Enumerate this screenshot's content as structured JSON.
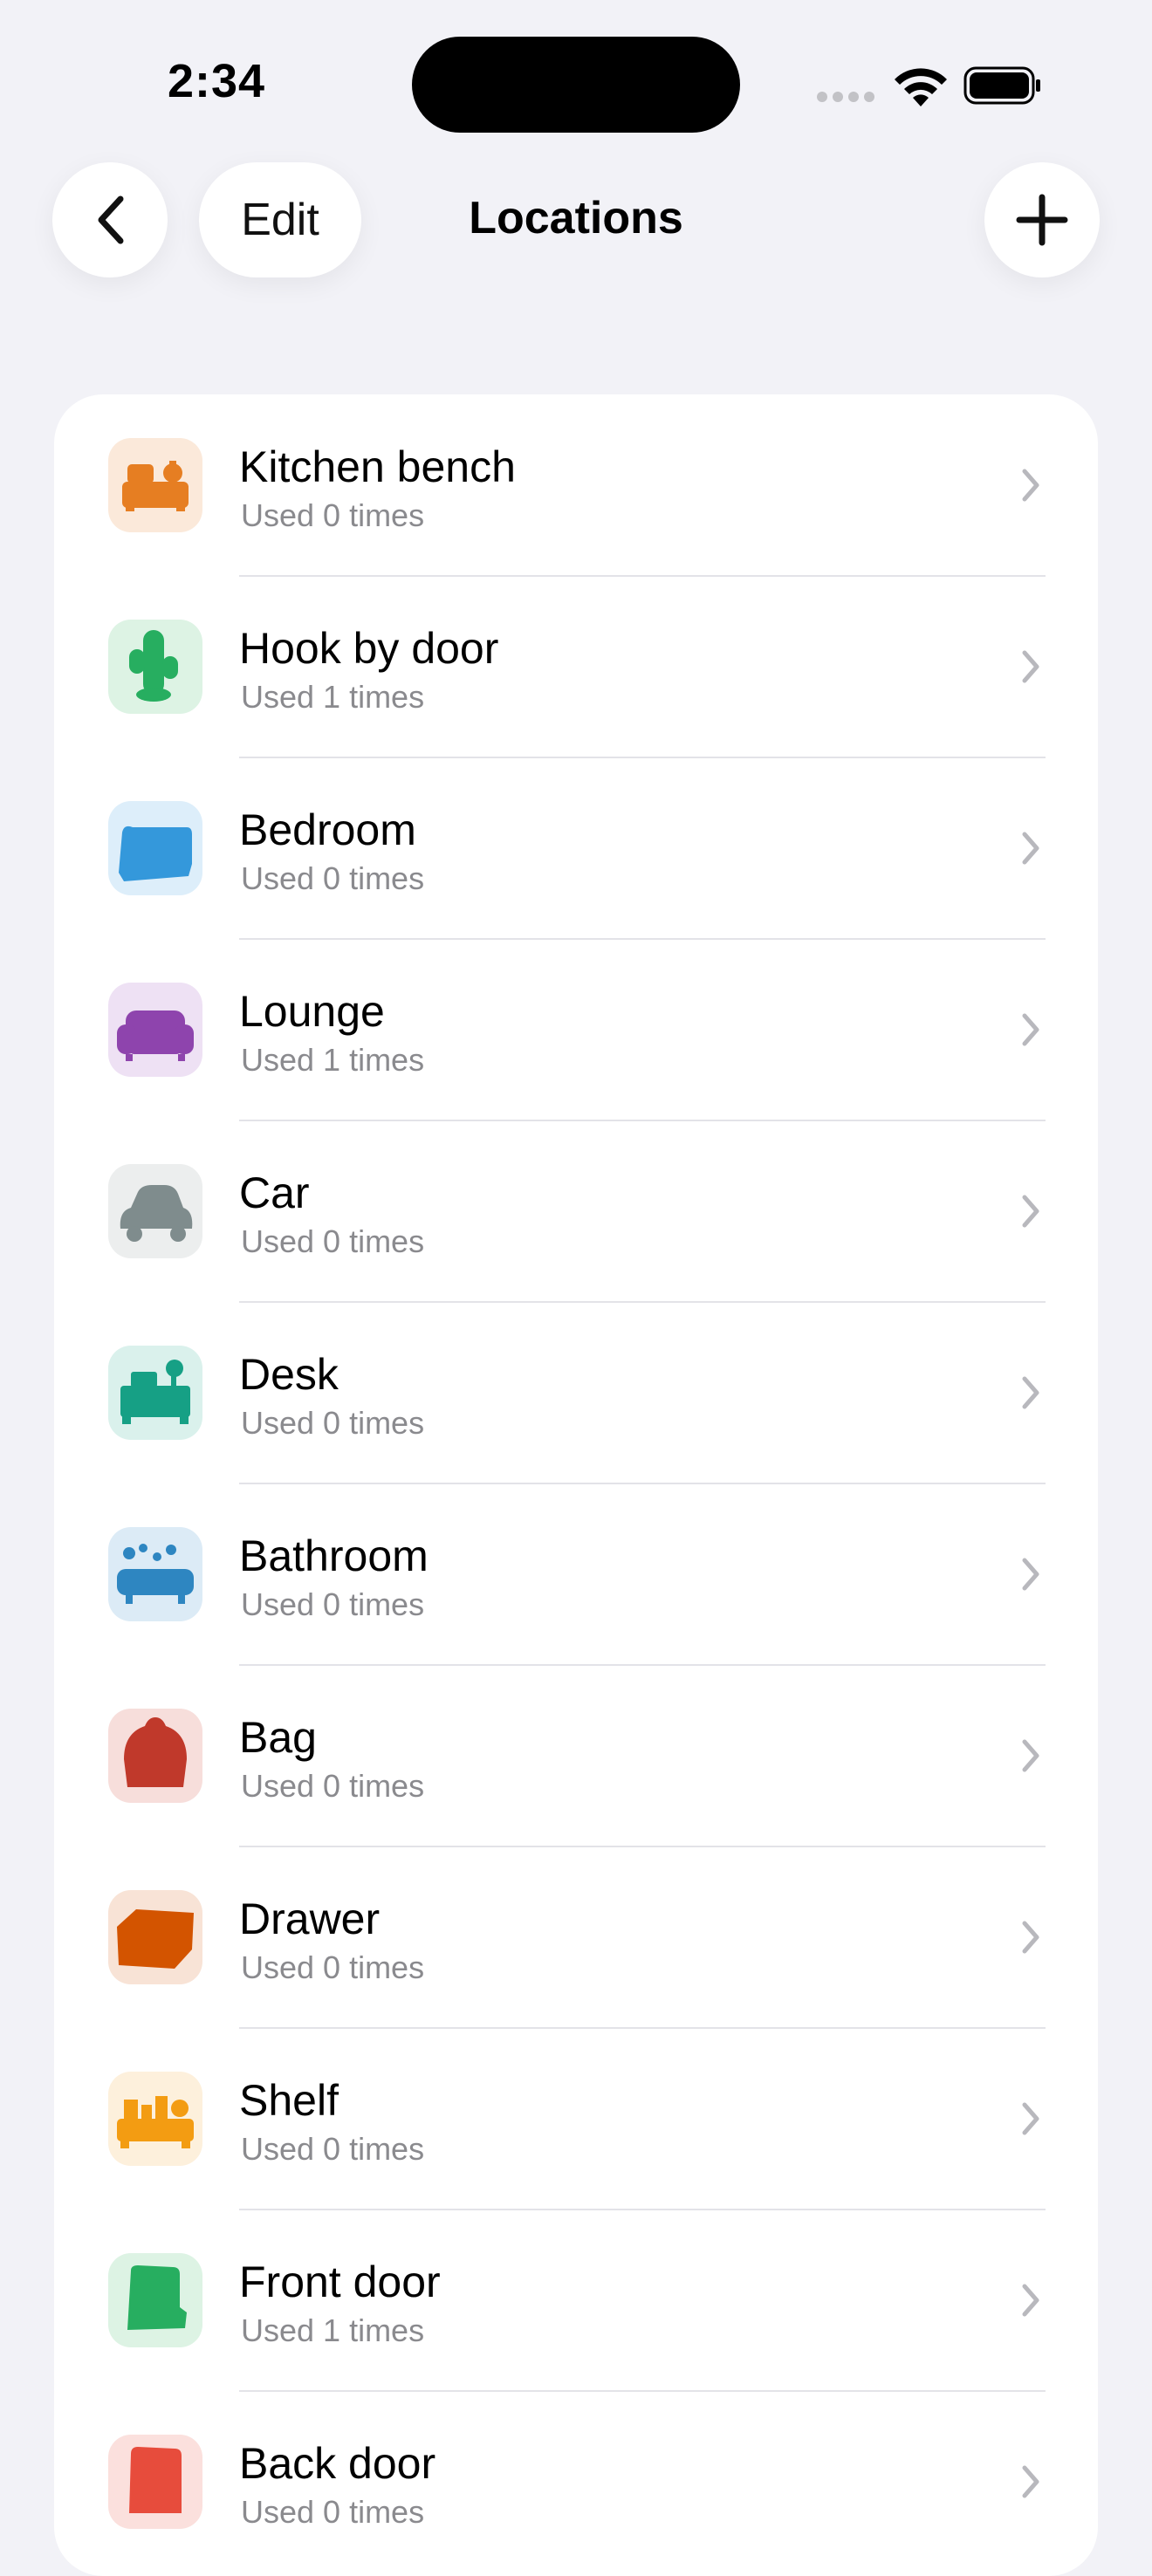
{
  "status_bar": {
    "time": "2:34"
  },
  "nav": {
    "edit_label": "Edit",
    "title": "Locations"
  },
  "locations": [
    {
      "name": "Kitchen bench",
      "usage": "Used 0 times",
      "icon": "kitchen-bench-icon",
      "color": "#E67E22",
      "bg": "#FBE9DA"
    },
    {
      "name": "Hook by door",
      "usage": "Used 1 times",
      "icon": "hook-icon",
      "color": "#27AE60",
      "bg": "#DDF3E4"
    },
    {
      "name": "Bedroom",
      "usage": "Used 0 times",
      "icon": "bed-icon",
      "color": "#3498DB",
      "bg": "#DDEEFA"
    },
    {
      "name": "Lounge",
      "usage": "Used 1 times",
      "icon": "sofa-icon",
      "color": "#8E44AD",
      "bg": "#EEE1F4"
    },
    {
      "name": "Car",
      "usage": "Used 0 times",
      "icon": "car-icon",
      "color": "#7F8C8D",
      "bg": "#ECEEEE"
    },
    {
      "name": "Desk",
      "usage": "Used 0 times",
      "icon": "desk-icon",
      "color": "#16A085",
      "bg": "#DAF1EC"
    },
    {
      "name": "Bathroom",
      "usage": "Used 0 times",
      "icon": "bathtub-icon",
      "color": "#2E86C1",
      "bg": "#DCEBF6"
    },
    {
      "name": "Bag",
      "usage": "Used 0 times",
      "icon": "bag-icon",
      "color": "#C0392B",
      "bg": "#F7DEDB"
    },
    {
      "name": "Drawer",
      "usage": "Used 0 times",
      "icon": "drawer-icon",
      "color": "#D35400",
      "bg": "#F8E3D6"
    },
    {
      "name": "Shelf",
      "usage": "Used 0 times",
      "icon": "shelf-icon",
      "color": "#F39C12",
      "bg": "#FDF0DC"
    },
    {
      "name": "Front door",
      "usage": "Used 1 times",
      "icon": "front-door-icon",
      "color": "#27AE60",
      "bg": "#DDF3E4"
    },
    {
      "name": "Back door",
      "usage": "Used 0 times",
      "icon": "back-door-icon",
      "color": "#E74C3C",
      "bg": "#FBE0DD"
    }
  ]
}
